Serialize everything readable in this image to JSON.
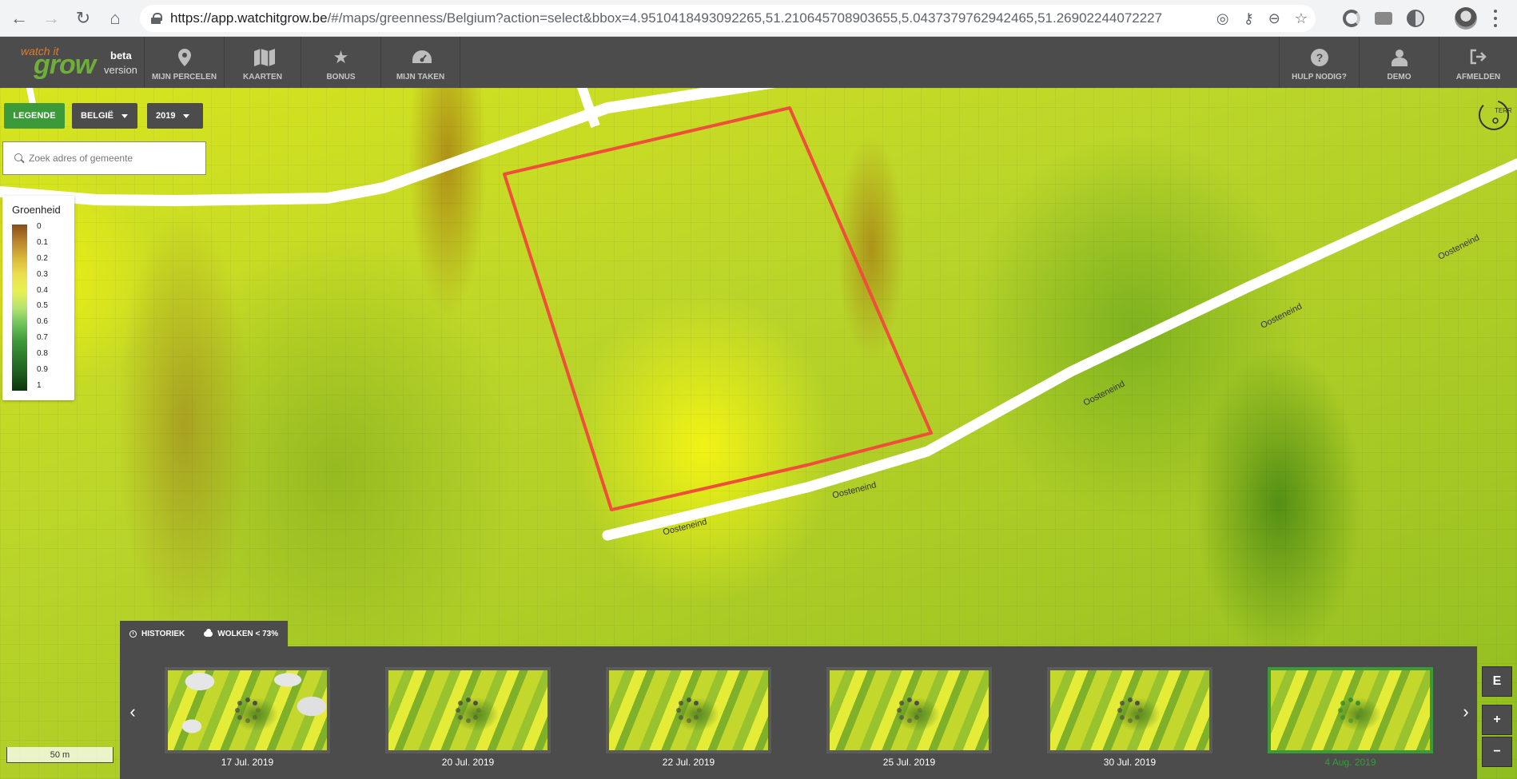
{
  "browser": {
    "url_host": "https://app.watchitgrow.be",
    "url_rest": "/#/maps/greenness/Belgium?action=select&bbox=4.9510418493092265,51.210645708903655,5.0437379762942465,51.26902244072227"
  },
  "header": {
    "brand_watch": "watch it",
    "brand_grow": "grow",
    "beta": "beta",
    "version": "version",
    "nav": {
      "mijn_percelen": "MIJN PERCELEN",
      "kaarten": "KAARTEN",
      "bonus": "BONUS",
      "mijn_taken": "MIJN TAKEN",
      "hulp": "HULP NODIG?",
      "demo": "DEMO",
      "afmelden": "AFMELDEN"
    }
  },
  "controls": {
    "legende": "LEGENDE",
    "region": "BELGIË",
    "year": "2019",
    "search_placeholder": "Zoek adres of gemeente"
  },
  "legend": {
    "title": "Groenheid",
    "ticks": [
      "0",
      "0.1",
      "0.2",
      "0.3",
      "0.4",
      "0.5",
      "0.6",
      "0.7",
      "0.8",
      "0.9",
      "1"
    ]
  },
  "map": {
    "road_labels": {
      "a": "Oosteneind",
      "b": "Oosteneind",
      "c": "Oosteneind",
      "d": "Oosteneind",
      "e": "Oosteneind"
    },
    "parcel_outline_color": "#f04e3a",
    "scale": "50 m"
  },
  "timeline": {
    "tab_historiek": "HISTORIEK",
    "tab_wolken": "WOLKEN < 73%",
    "dates": [
      "17 Jul. 2019",
      "20 Jul. 2019",
      "22 Jul. 2019",
      "25 Jul. 2019",
      "30 Jul. 2019",
      "4 Aug. 2019"
    ],
    "active_index": 5
  },
  "map_controls": {
    "e": "E",
    "zoom_in": "+",
    "zoom_out": "−"
  }
}
